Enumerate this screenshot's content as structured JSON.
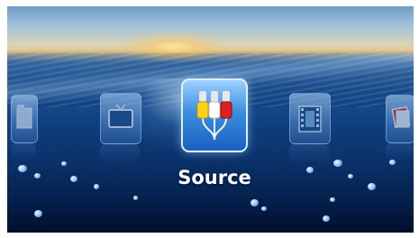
{
  "menu": {
    "selected_label": "Source",
    "items": [
      {
        "name": "folder-icon"
      },
      {
        "name": "tv-icon"
      },
      {
        "name": "av-cable-icon"
      },
      {
        "name": "film-icon"
      },
      {
        "name": "photos-icon"
      }
    ]
  },
  "colors": {
    "selected_icon": "#3b8fe0",
    "label": "#ffffff"
  }
}
